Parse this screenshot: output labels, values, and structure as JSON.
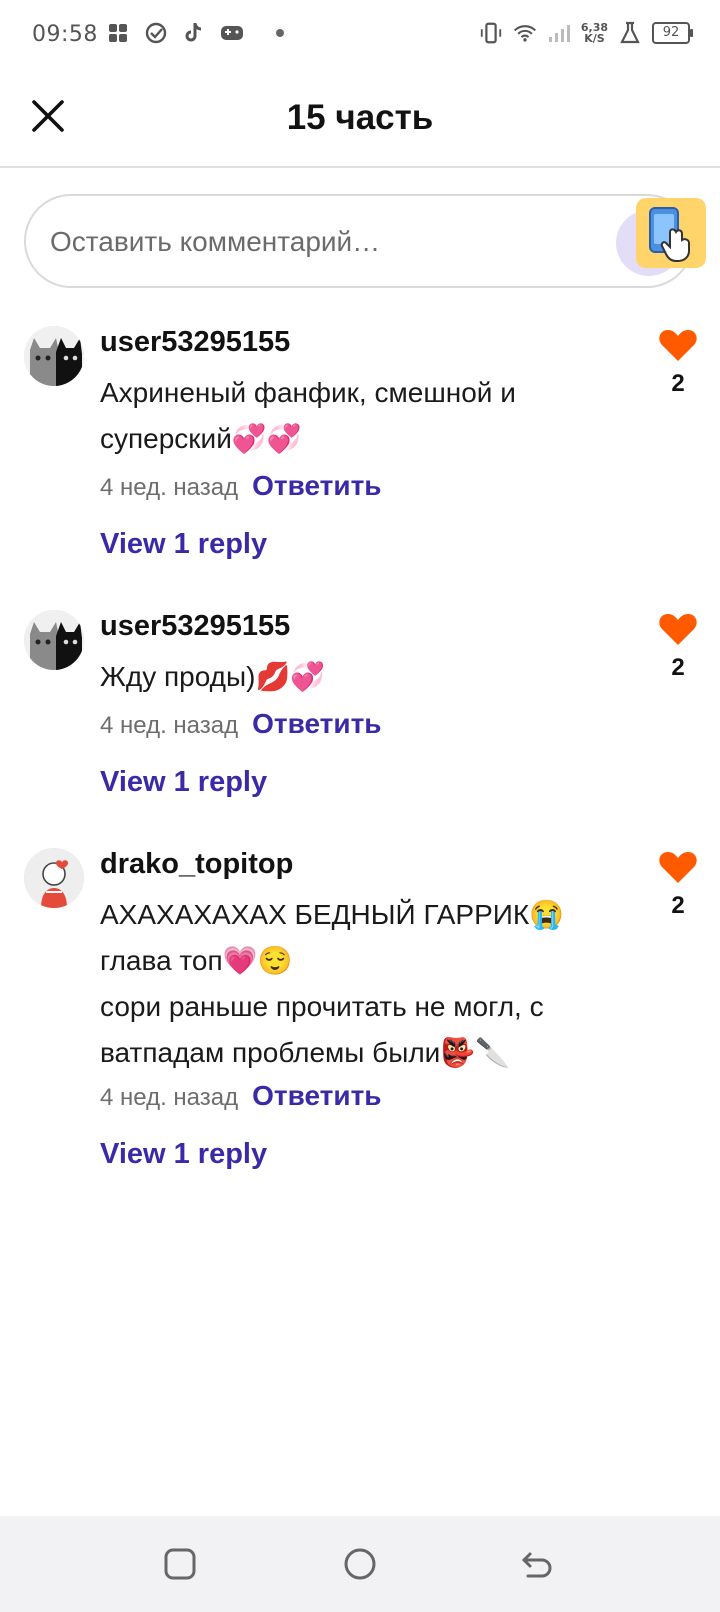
{
  "status_bar": {
    "time": "09:58",
    "network_speed_value": "6,38",
    "network_speed_unit": "K/S",
    "battery": "92"
  },
  "header": {
    "title": "15 часть"
  },
  "comment_box": {
    "placeholder": "Оставить комментарий…"
  },
  "comments": [
    {
      "username": "user53295155",
      "text": "Ахриненый фанфик, смешной и суперский💞💞",
      "time_ago": "4 нед. назад",
      "reply_label": "Ответить",
      "view_replies": "View 1 reply",
      "likes": "2"
    },
    {
      "username": "user53295155",
      "text": "Жду проды)💋💞",
      "time_ago": "4 нед. назад",
      "reply_label": "Ответить",
      "view_replies": "View 1 reply",
      "likes": "2"
    },
    {
      "username": "drako_topitop",
      "text": "АХАХАХАХАХ БЕДНЫЙ ГАРРИК😭\nглава топ💗😌\nсори раньше прочитать не могл, с ватпадам проблемы были👺🔪",
      "time_ago": "4 нед. назад",
      "reply_label": "Ответить",
      "view_replies": "View 1 reply",
      "likes": "2"
    }
  ],
  "colors": {
    "accent": "#3b2aa8",
    "like": "#ff5a00",
    "divider": "#e0e0e0"
  }
}
